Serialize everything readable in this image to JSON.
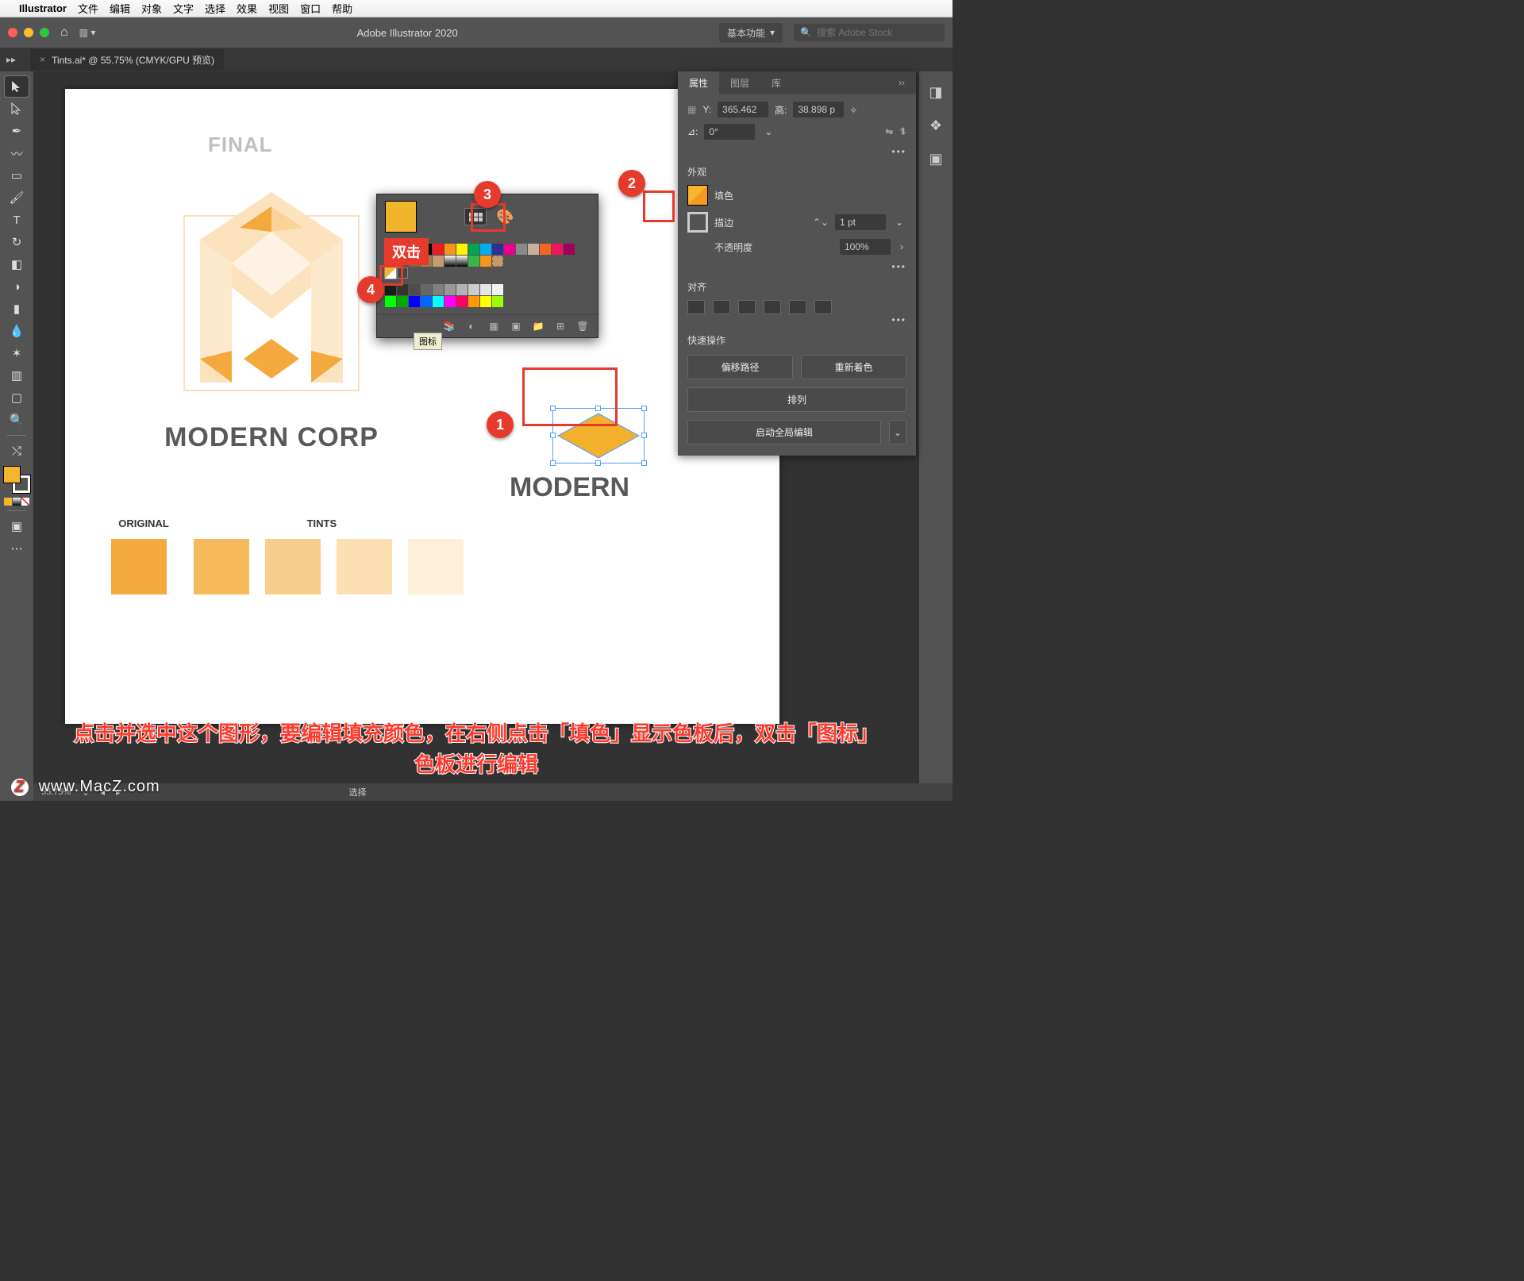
{
  "macmenu": {
    "app": "Illustrator",
    "items": [
      "文件",
      "编辑",
      "对象",
      "文字",
      "选择",
      "效果",
      "视图",
      "窗口",
      "帮助"
    ]
  },
  "window": {
    "title": "Adobe Illustrator 2020",
    "workspace": "基本功能",
    "search_placeholder": "搜索 Adobe Stock"
  },
  "tab": {
    "name": "Tints.ai* @ 55.75% (CMYK/GPU 预览)"
  },
  "artboard": {
    "final": "FINAL",
    "brand": "MODERN CORP",
    "brand2": "MODERN",
    "original_label": "ORIGINAL",
    "tints_label": "TINTS",
    "swatches": [
      "#f4a93e",
      "#f6b95b",
      "#f9cd8a",
      "#fbdfb2",
      "#fdefd8"
    ]
  },
  "properties": {
    "tabs": {
      "attr": "属性",
      "layers": "图层",
      "lib": "库"
    },
    "y_label": "Y:",
    "y_val": "365.462",
    "h_label": "高:",
    "h_val": "38.898 p",
    "angle_label": "⊿:",
    "angle_val": "0°",
    "appearance": "外观",
    "fill_label": "填色",
    "stroke_label": "描边",
    "stroke_val": "1 pt",
    "opacity_label": "不透明度",
    "opacity_val": "100%",
    "align": "对齐",
    "quick": "快速操作",
    "offset_path": "偏移路径",
    "recolor": "重新着色",
    "arrange": "排列",
    "global_edit": "启动全局编辑"
  },
  "swatch_popup": {
    "tooltip": "图标",
    "dbl": "双击"
  },
  "annotations": {
    "b1": "1",
    "b2": "2",
    "b3": "3",
    "b4": "4"
  },
  "caption_line1": "点击并选中这个图形，要编辑填充颜色，在右侧点击「填色」显示色板后，双击「图标」",
  "caption_line2": "色板进行编辑",
  "watermark": "www.MacZ.com",
  "status": {
    "zoom": "55.75%",
    "tool": "选择"
  }
}
